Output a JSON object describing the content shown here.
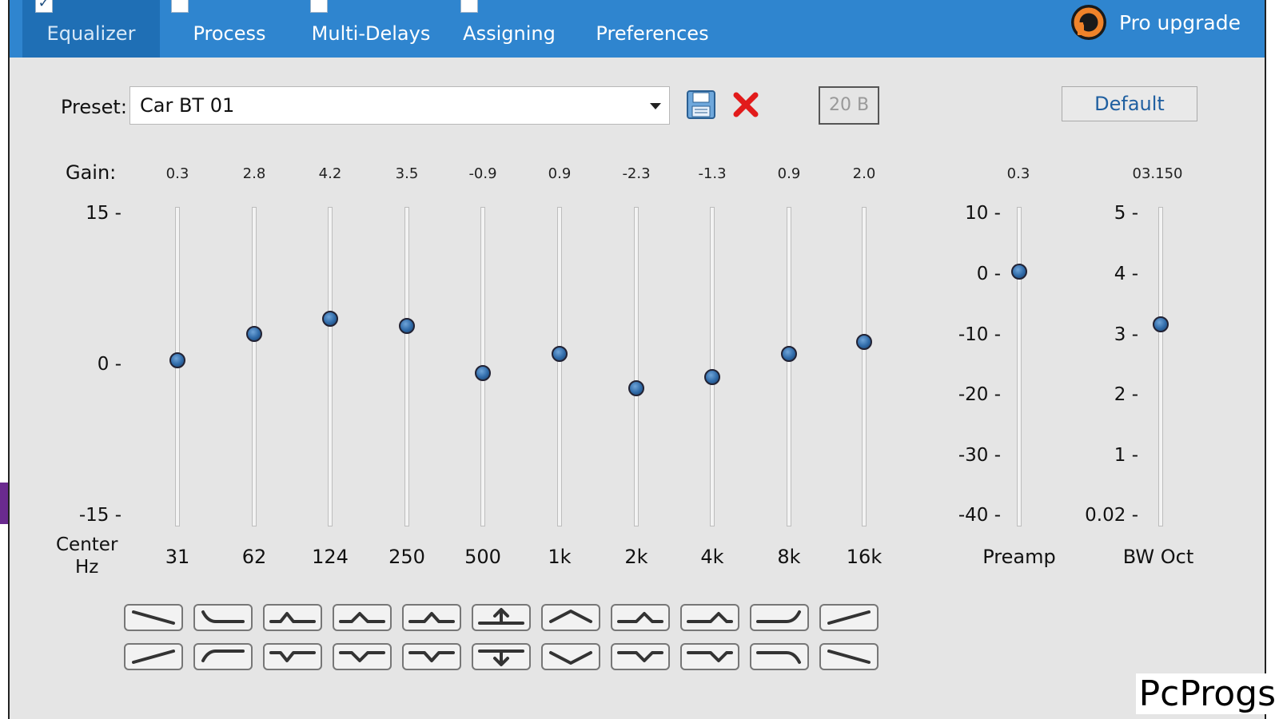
{
  "tabs": [
    {
      "label": "Equalizer",
      "active": true,
      "checked": true
    },
    {
      "label": "Process",
      "active": false,
      "checked": false
    },
    {
      "label": "Multi-Delays",
      "active": false,
      "checked": false
    },
    {
      "label": "Assigning",
      "active": false,
      "checked": false
    },
    {
      "label": "Preferences",
      "active": false,
      "checked": null
    }
  ],
  "pro_upgrade": "Pro upgrade",
  "preset": {
    "label": "Preset:",
    "value": "Car BT 01"
  },
  "bits": "20 B",
  "default_label": "Default",
  "gain_label": "Gain:",
  "center_hz_label": [
    "Center",
    "Hz"
  ],
  "eq_scale": [
    "15 -",
    "0 -",
    "-15 -"
  ],
  "bands": [
    {
      "freq": "31",
      "gain": "0.3",
      "level": 0.3
    },
    {
      "freq": "62",
      "gain": "2.8",
      "level": 2.8
    },
    {
      "freq": "124",
      "gain": "4.2",
      "level": 4.2
    },
    {
      "freq": "250",
      "gain": "3.5",
      "level": 3.5
    },
    {
      "freq": "500",
      "gain": "-0.9",
      "level": -0.9
    },
    {
      "freq": "1k",
      "gain": "0.9",
      "level": 0.9
    },
    {
      "freq": "2k",
      "gain": "-2.3",
      "level": -2.3
    },
    {
      "freq": "4k",
      "gain": "-1.3",
      "level": -1.3
    },
    {
      "freq": "8k",
      "gain": "0.9",
      "level": 0.9
    },
    {
      "freq": "16k",
      "gain": "2.0",
      "level": 2.0
    }
  ],
  "preamp": {
    "label": "Preamp",
    "value": "0.3",
    "scale": [
      "10 -",
      "0 -",
      "-10 -",
      "-20 -",
      "-30 -",
      "-40 -"
    ],
    "level": 0.3
  },
  "bw": {
    "label": "BW Oct",
    "value": "03.150",
    "scale": [
      "5 -",
      "4 -",
      "3 -",
      "2 -",
      "1 -",
      "0.02 -"
    ],
    "level": 3.15
  },
  "shape_buttons_top": [
    "slope-down",
    "low-shelf-cut",
    "bell-boost-low",
    "bell-boost",
    "bell-boost-mid",
    "raise-all",
    "bell-boost-wide",
    "bell-boost-high",
    "high-bell-boost",
    "high-shelf-boost",
    "slope-up"
  ],
  "shape_buttons_bottom": [
    "slope-up",
    "low-shelf-boost",
    "bell-cut-low",
    "bell-cut",
    "bell-cut-mid",
    "lower-all",
    "bell-cut-wide",
    "bell-cut-high",
    "high-bell-cut",
    "high-shelf-cut",
    "slope-down"
  ],
  "watermark": "PcProgs",
  "colors": {
    "tabbar": "#2f85cf",
    "tab_active": "#1f6fb5",
    "panel": "#e5e5e5",
    "knob": "#2f6aa8",
    "delete": "#e21b1b",
    "default_text": "#1f5fa0"
  }
}
